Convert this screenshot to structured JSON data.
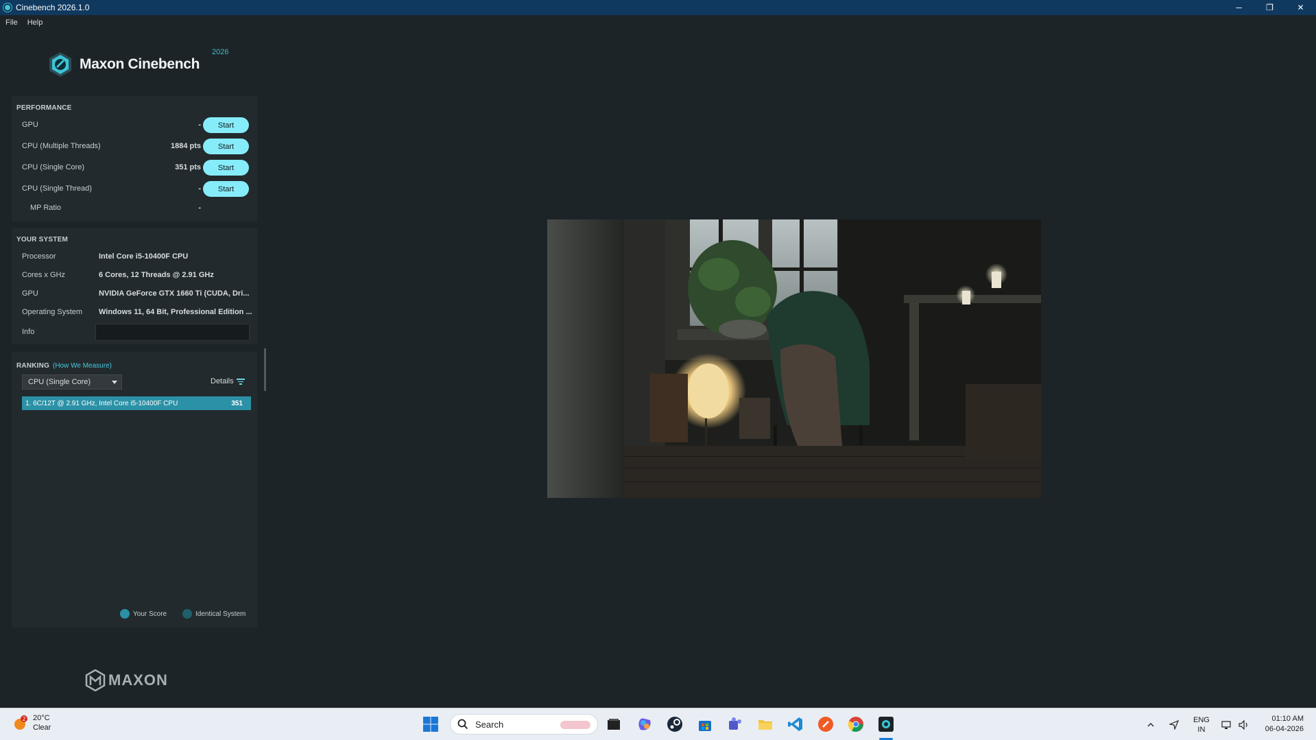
{
  "window": {
    "title": "Cinebench 2026.1.0",
    "minimize": "─",
    "restore": "❐",
    "close": "✕"
  },
  "menu": [
    "File",
    "Help"
  ],
  "logo": {
    "text": "Maxon Cinebench",
    "year": "2026"
  },
  "performance": {
    "title": "PERFORMANCE",
    "start_label": "Start",
    "rows": [
      {
        "label": "GPU",
        "value": "-"
      },
      {
        "label": "CPU (Multiple Threads)",
        "value": "1884 pts"
      },
      {
        "label": "CPU (Single Core)",
        "value": "351 pts"
      },
      {
        "label": "CPU (Single Thread)",
        "value": "-"
      }
    ],
    "mp_ratio": {
      "label": "MP Ratio",
      "value": "-"
    }
  },
  "system": {
    "title": "YOUR SYSTEM",
    "rows": [
      {
        "label": "Processor",
        "value": "Intel Core i5-10400F CPU"
      },
      {
        "label": "Cores x GHz",
        "value": "6 Cores, 12 Threads @ 2.91 GHz"
      },
      {
        "label": "GPU",
        "value": "NVIDIA GeForce GTX 1660 Ti (CUDA, Dri..."
      },
      {
        "label": "Operating System",
        "value": "Windows 11, 64 Bit, Professional Edition ..."
      }
    ],
    "info_label": "Info",
    "info_value": ""
  },
  "ranking": {
    "title": "RANKING",
    "how_link": "(How We Measure)",
    "selected_mode": "CPU (Single Core)",
    "details_label": "Details",
    "entries": [
      {
        "text": "1. 6C/12T @ 2.91 GHz, Intel Core i5-10400F CPU",
        "score": "351"
      }
    ],
    "legend": [
      {
        "label": "Your Score",
        "color": "#2b91a6"
      },
      {
        "label": "Identical System",
        "color": "#1f5f6b"
      }
    ]
  },
  "brand": {
    "maxon": "MAXON"
  },
  "colors": {
    "accent": "#87ecfa",
    "ranking_highlight": "#2b91a6",
    "titlebar": "#10395f"
  },
  "taskbar": {
    "weather": {
      "temp": "20°C",
      "condition": "Clear",
      "badge": "2"
    },
    "search_placeholder": "Search",
    "apps": [
      "start-icon",
      "file-manager-icon",
      "copilot-icon",
      "steam-icon",
      "store-icon",
      "teams-icon",
      "file-explorer-icon",
      "vscode-icon",
      "postman-icon",
      "chrome-icon",
      "cinebench-icon"
    ],
    "language": {
      "lang": "ENG",
      "region": "IN"
    },
    "clock": {
      "time": "01:10 AM",
      "date": "06-04-2026"
    }
  }
}
